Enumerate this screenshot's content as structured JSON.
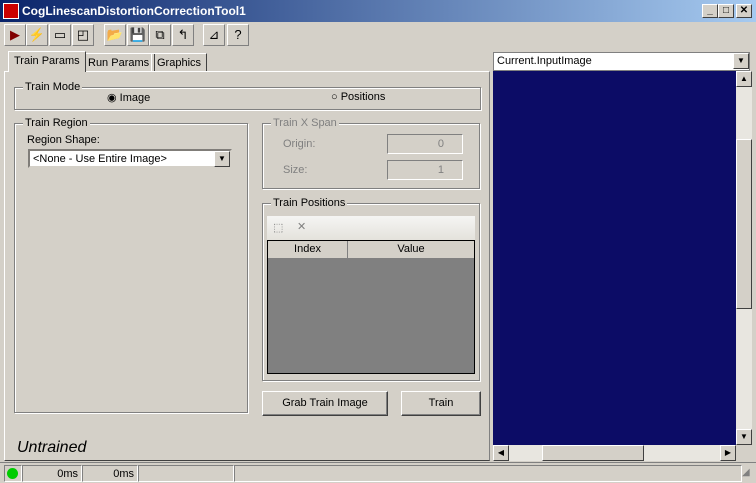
{
  "window": {
    "title": "CogLinescanDistortionCorrectionTool1",
    "minimize": "_",
    "maximize": "□",
    "close": "✕"
  },
  "toolbar": [
    {
      "icon": "run-icon",
      "glyph": "▶"
    },
    {
      "icon": "electric-icon",
      "glyph": "⚡"
    },
    {
      "icon": "show-tool-icon",
      "glyph": "▭"
    },
    {
      "icon": "floating-icon",
      "glyph": "◰"
    },
    {
      "icon": "open-icon",
      "glyph": "📂"
    },
    {
      "icon": "save-icon",
      "glyph": "💾"
    },
    {
      "icon": "save-as-icon",
      "glyph": "⧉"
    },
    {
      "icon": "reset-icon",
      "glyph": "↰"
    },
    {
      "icon": "tool-icon",
      "glyph": "⊿"
    },
    {
      "icon": "help-icon",
      "glyph": "?"
    }
  ],
  "tabs": [
    "Train Params",
    "Run Params",
    "Graphics"
  ],
  "train_mode": {
    "label": "Train Mode",
    "options": [
      "Image",
      "Positions"
    ],
    "selected": "Image"
  },
  "train_region": {
    "label": "Train Region",
    "shape_label": "Region Shape:",
    "shape_value": "<None - Use Entire Image>"
  },
  "train_x_span": {
    "label": "Train X Span",
    "origin_label": "Origin:",
    "origin_value": "0",
    "size_label": "Size:",
    "size_value": "1"
  },
  "train_positions": {
    "label": "Train Positions",
    "columns": [
      "Index",
      "Value"
    ],
    "rows": []
  },
  "buttons": {
    "grab": "Grab Train Image",
    "train": "Train"
  },
  "status": "Untrained",
  "statusbar": {
    "time1": "0ms",
    "time2": "0ms",
    "indicator_color": "#00cc00"
  },
  "image_view": {
    "selector": "Current.InputImage",
    "background": "#0c0c66",
    "vscroll": 0.3,
    "hscroll": 0.3
  }
}
